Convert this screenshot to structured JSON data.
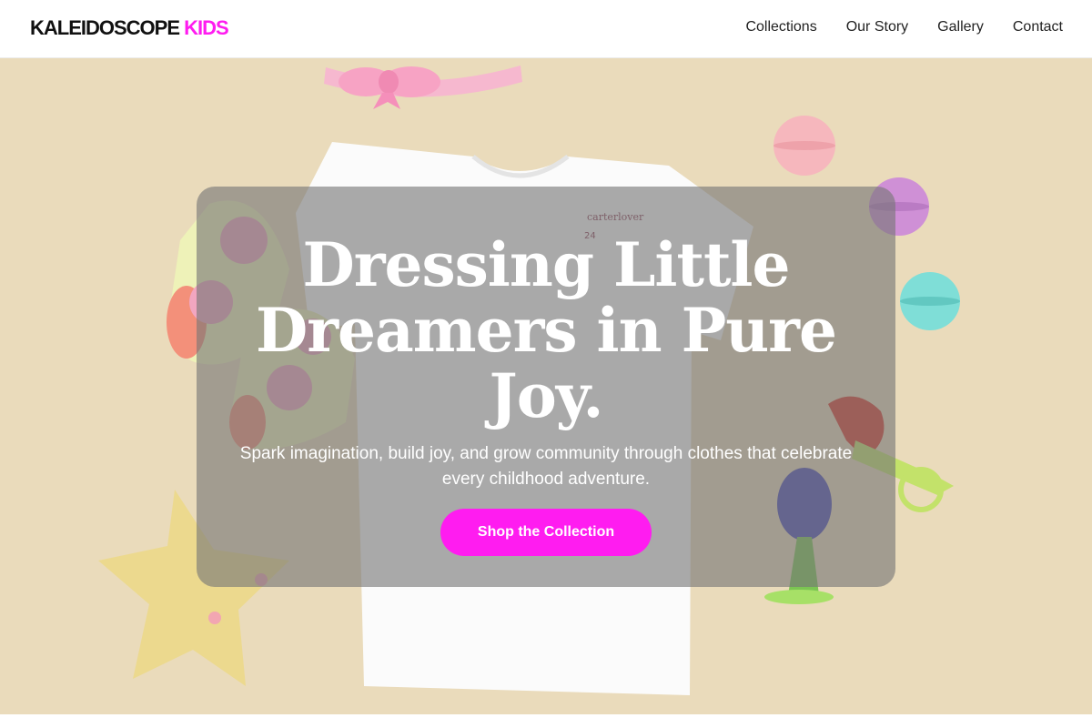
{
  "brand": {
    "name": "KALEIDOSCOPE",
    "accent": "KIDS"
  },
  "nav": {
    "items": [
      {
        "label": "Collections"
      },
      {
        "label": "Our Story"
      },
      {
        "label": "Gallery"
      },
      {
        "label": "Contact"
      }
    ]
  },
  "hero": {
    "headline": "Dressing Little Dreamers in Pure Joy.",
    "subtitle": "Spark imagination, build joy, and grow community through clothes that celebrate every childhood adventure.",
    "cta_label": "Shop the Collection",
    "tshirt_tag": {
      "brand": "carterlover",
      "size": "24"
    }
  },
  "colors": {
    "accent": "#ff1cf0",
    "hero_background": "#eadbbb",
    "overlay": "rgba(118,118,118,0.62)"
  }
}
